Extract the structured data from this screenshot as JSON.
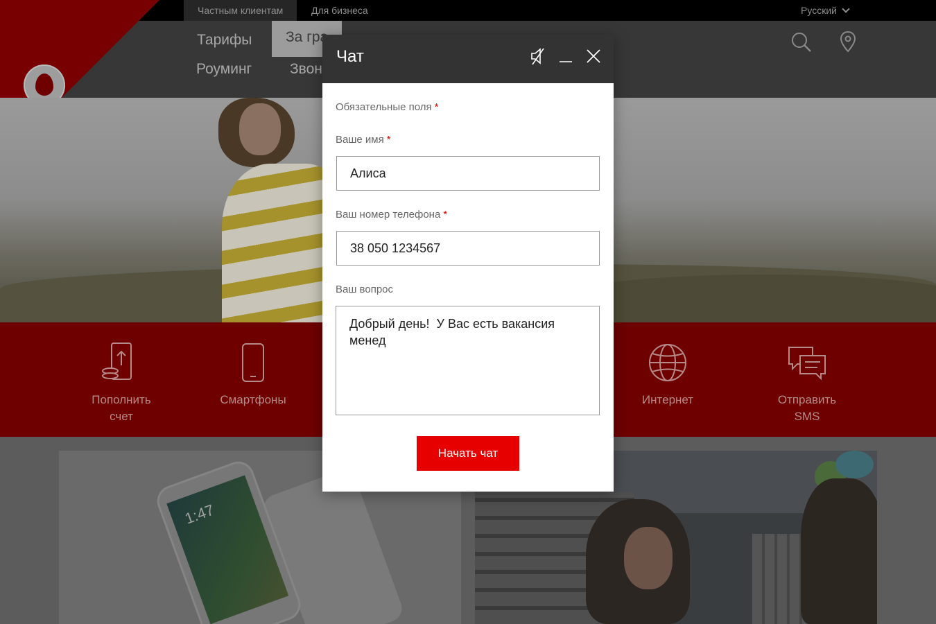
{
  "topbar": {
    "tabs": [
      {
        "label": "Частным клиентам",
        "active": true
      },
      {
        "label": "Для бизнеса",
        "active": false
      }
    ],
    "language": "Русский"
  },
  "nav": {
    "items": [
      "Тарифы",
      "За гра",
      "Роуминг",
      "Звон"
    ],
    "icons": [
      "search-icon",
      "location-pin-icon"
    ]
  },
  "services": [
    {
      "label": "Пополнить счет",
      "icon": "top-up-icon"
    },
    {
      "label": "Смартфоны",
      "icon": "smartphone-icon"
    },
    {
      "label": "Интернет",
      "icon": "globe-icon"
    },
    {
      "label": "Отправить SMS",
      "icon": "sms-icon"
    }
  ],
  "promo": {
    "phone_time": "1:47"
  },
  "chat": {
    "title": "Чат",
    "icons": [
      "sound-off-icon",
      "minimize-icon",
      "close-icon"
    ],
    "required_note": "Обязательные поля",
    "required_mark": "*",
    "name_label": "Ваше имя",
    "name_value": "Алиса",
    "phone_label": "Ваш номер телефона",
    "phone_value": "38 050 1234567",
    "question_label": "Ваш вопрос",
    "question_value": "Добрый день!  У Вас есть вакансия менед",
    "submit_label": "Начать чат"
  },
  "colors": {
    "brand_red": "#e60000",
    "header_dark": "#333333",
    "overlay_red": "#6e0000"
  }
}
